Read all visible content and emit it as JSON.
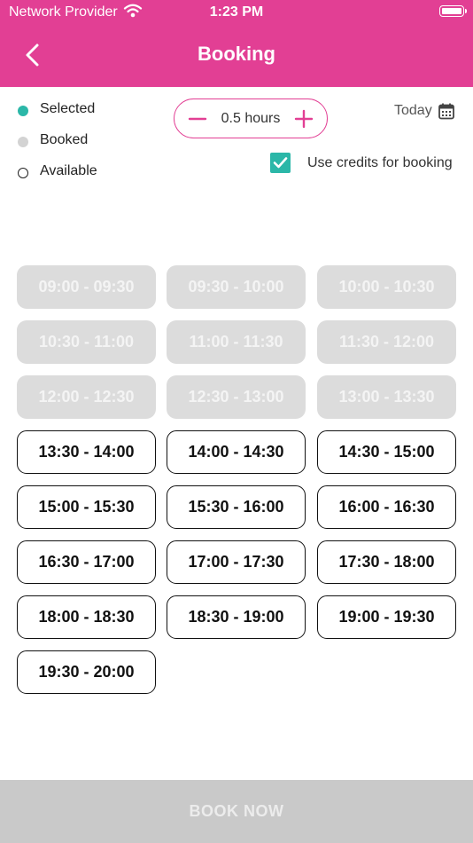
{
  "status_bar": {
    "carrier": "Network Provider",
    "time": "1:23 PM"
  },
  "header": {
    "title": "Booking"
  },
  "legend": [
    {
      "label": "Selected",
      "type": "selected",
      "color": "#2bb7a8"
    },
    {
      "label": "Booked",
      "type": "booked",
      "color": "#d3d3d3"
    },
    {
      "label": "Available",
      "type": "available",
      "color": "#ffffff"
    }
  ],
  "duration": {
    "value": "0.5 hours"
  },
  "date": {
    "label": "Today"
  },
  "credits": {
    "label": "Use credits for booking",
    "checked": true
  },
  "slots": [
    {
      "label": "09:00 - 09:30",
      "state": "booked"
    },
    {
      "label": "09:30 - 10:00",
      "state": "booked"
    },
    {
      "label": "10:00 - 10:30",
      "state": "booked"
    },
    {
      "label": "10:30 - 11:00",
      "state": "booked"
    },
    {
      "label": "11:00 - 11:30",
      "state": "booked"
    },
    {
      "label": "11:30 - 12:00",
      "state": "booked"
    },
    {
      "label": "12:00 - 12:30",
      "state": "booked"
    },
    {
      "label": "12:30 - 13:00",
      "state": "booked"
    },
    {
      "label": "13:00 - 13:30",
      "state": "booked"
    },
    {
      "label": "13:30 - 14:00",
      "state": "available"
    },
    {
      "label": "14:00 - 14:30",
      "state": "available"
    },
    {
      "label": "14:30 - 15:00",
      "state": "available"
    },
    {
      "label": "15:00 - 15:30",
      "state": "available"
    },
    {
      "label": "15:30 - 16:00",
      "state": "available"
    },
    {
      "label": "16:00 - 16:30",
      "state": "available"
    },
    {
      "label": "16:30 - 17:00",
      "state": "available"
    },
    {
      "label": "17:00 - 17:30",
      "state": "available"
    },
    {
      "label": "17:30 - 18:00",
      "state": "available"
    },
    {
      "label": "18:00 - 18:30",
      "state": "available"
    },
    {
      "label": "18:30 - 19:00",
      "state": "available"
    },
    {
      "label": "19:00 - 19:30",
      "state": "available"
    },
    {
      "label": "19:30 - 20:00",
      "state": "available"
    }
  ],
  "footer": {
    "book_label": "BOOK NOW",
    "enabled": false
  },
  "colors": {
    "accent": "#e23f94",
    "selected": "#2bb7a8",
    "booked": "#dcdcdc",
    "disabled_button": "#c9c9c9"
  },
  "icons": {
    "back": "chevron-left-icon",
    "minus": "minus-icon",
    "plus": "plus-icon",
    "calendar": "calendar-icon",
    "check": "check-icon",
    "wifi": "wifi-icon",
    "battery": "battery-icon"
  }
}
